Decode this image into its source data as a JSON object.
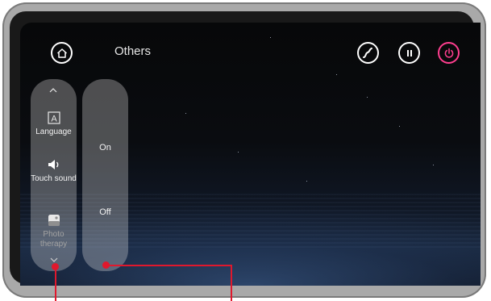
{
  "header": {
    "title": "Others"
  },
  "sidebar": {
    "items": [
      {
        "label": "Language",
        "icon": "language-icon"
      },
      {
        "label": "Touch sound",
        "icon": "speaker-icon"
      },
      {
        "label": "Photo therapy",
        "icon": "photo-therapy-icon"
      }
    ]
  },
  "options": {
    "on_label": "On",
    "off_label": "Off"
  },
  "toolbar": {
    "icons": [
      "home-icon",
      "curve-icon",
      "pause-icon",
      "power-icon"
    ]
  },
  "colors": {
    "accent_power": "#ff3e8f",
    "callout": "#e0182d"
  }
}
